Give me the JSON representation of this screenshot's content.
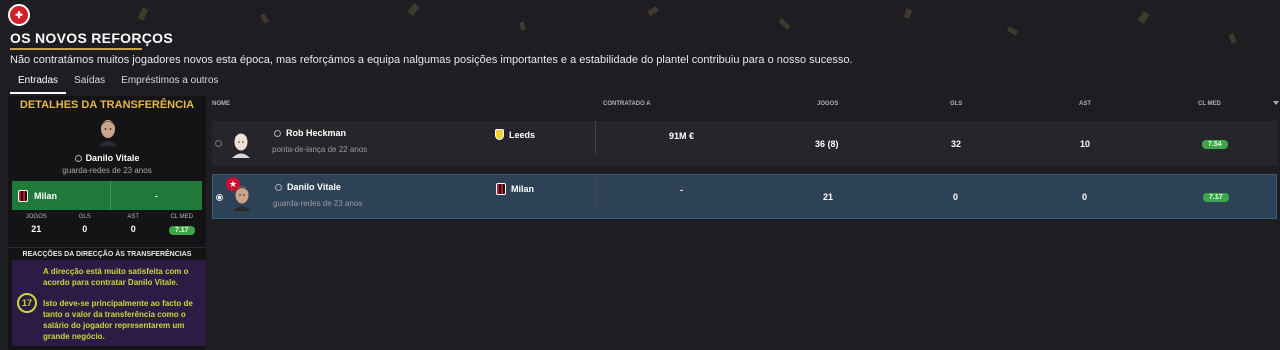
{
  "header": {
    "club_badge_icon": "club-crest-icon",
    "title": "OS NOVOS REFORÇOS",
    "subtitle": "Não contratámos muitos jogadores novos esta época, mas reforçámos a equipa nalgumas posições importantes e a estabilidade do plantel contribuiu para o nosso sucesso."
  },
  "tabs": [
    {
      "label": "Entradas",
      "active": true
    },
    {
      "label": "Saídas",
      "active": false
    },
    {
      "label": "Empréstimos a outros",
      "active": false
    }
  ],
  "detail_panel": {
    "title": "DETALHES DA TRANSFERÊNCIA",
    "player_name": "Danilo Vitale",
    "player_desc": "guarda-redes de 23 anos",
    "club_from": "Milan",
    "club_to": "-",
    "stats_headers": [
      "JOGOS",
      "GLS",
      "AST",
      "CL MED"
    ],
    "stats_values": [
      "21",
      "0",
      "0",
      "7.17"
    ],
    "reactions_title": "REACÇÕES DA DIRECÇÃO ÀS TRANSFERÊNCIAS",
    "mood_value": "17",
    "reaction_line1": "A direcção está muito satisfeita com o acordo para contratar Danilo Vitale.",
    "reaction_line2": "Isto deve-se principalmente ao facto de tanto o valor da transferência como o salário do jogador representarem um grande negócio."
  },
  "table": {
    "headers": {
      "name": "NOME",
      "contracted": "CONTRATADO A",
      "games": "JOGOS",
      "goals": "GLS",
      "assists": "AST",
      "rating": "CL MED"
    },
    "rows": [
      {
        "name": "Rob Heckman",
        "desc": "ponta-de-lança de 22 anos",
        "club": "Leeds",
        "fee": "91M €",
        "games": "36 (8)",
        "goals": "32",
        "assists": "10",
        "rating": "7.54"
      },
      {
        "name": "Danilo Vitale",
        "desc": "guarda-redes de 23 anos",
        "club": "Milan",
        "fee": "-",
        "games": "21",
        "goals": "0",
        "assists": "0",
        "rating": "7.17"
      }
    ]
  }
}
